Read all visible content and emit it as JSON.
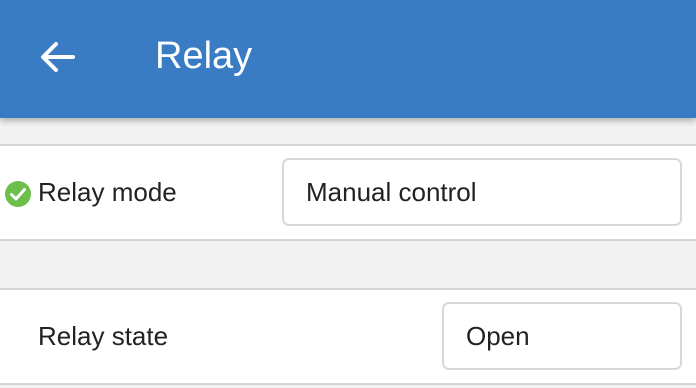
{
  "header": {
    "title": "Relay",
    "back_icon": "arrow-left-icon",
    "background_color": "#3a7cc4"
  },
  "settings": {
    "relay_mode": {
      "label": "Relay mode",
      "value": "Manual control",
      "status_icon": "check-circle-icon",
      "status_color": "#6bbf4a"
    },
    "relay_state": {
      "label": "Relay state",
      "value": "Open"
    }
  }
}
